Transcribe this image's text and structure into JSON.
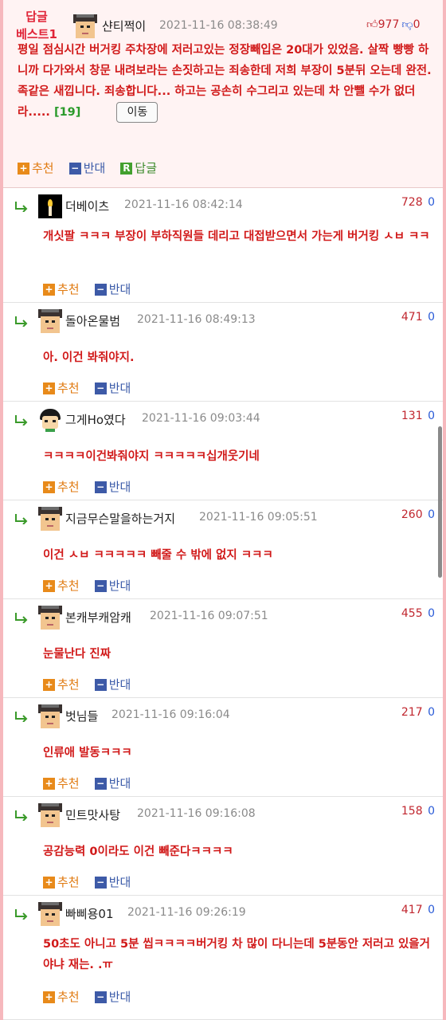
{
  "best": {
    "badge_line1": "답글",
    "badge_line2": "베스트1",
    "author": "샨티쩍이",
    "time": "2021-11-16 08:38:49",
    "up_count": "977",
    "down_count": "0",
    "text": "평일 점심시간 버거킹 주차장에 저러고있는 정장빼입은 20대가 있었음. 살짝 빵빵 하니까 다가와서 창문 내려보라는 손짓하고는 죄송한데 저희 부장이 5분뒤 오는데 완전.족같은 새낍니다. 죄송합니다... 하고는 공손히 수그리고 있는데 차 안뺄 수가 없더라.....",
    "comment_count": "[19]",
    "move_label": "이동",
    "recommend_label": "추천",
    "oppose_label": "반대",
    "reply_label": "답글"
  },
  "labels": {
    "recommend": "추천",
    "oppose": "반대"
  },
  "replies": [
    {
      "author": "더베이츠",
      "time": "2021-11-16 08:42:14",
      "up": "728",
      "down": "0",
      "text": "개싯팔 ㅋㅋㅋ 부장이 부하직원들 데리고 대접받으면서 가는게 버거킹 ㅅㅂ ㅋㅋ",
      "avatar": "candle"
    },
    {
      "author": "돌아온물범",
      "time": "2021-11-16 08:49:13",
      "up": "471",
      "down": "0",
      "text": "아. 이건 봐줘야지.",
      "avatar": "default"
    },
    {
      "author": "그게Ho였다",
      "time": "2021-11-16 09:03:44",
      "up": "131",
      "down": "0",
      "text": "ㅋㅋㅋㅋ이건봐줘야지 ㅋㅋㅋㅋㅋ십개웃기네",
      "avatar": "character"
    },
    {
      "author": "지금무슨말을하는거지",
      "time": "2021-11-16 09:05:51",
      "up": "260",
      "down": "0",
      "text": "이건 ㅅㅂ ㅋㅋㅋㅋㅋ 빼줄 수 밖에 없지 ㅋㅋㅋ",
      "avatar": "default"
    },
    {
      "author": "본캐부캐암캐",
      "time": "2021-11-16 09:07:51",
      "up": "455",
      "down": "0",
      "text": "눈물난다 진짜",
      "avatar": "default"
    },
    {
      "author": "벗님들",
      "time": "2021-11-16 09:16:04",
      "up": "217",
      "down": "0",
      "text": "인류애 발동ㅋㅋㅋ",
      "avatar": "default"
    },
    {
      "author": "민트맛사탕",
      "time": "2021-11-16 09:16:08",
      "up": "158",
      "down": "0",
      "text": "공감능력 0이라도 이건 빼준다ㅋㅋㅋㅋ",
      "avatar": "default"
    },
    {
      "author": "빠삐용01",
      "time": "2021-11-16 09:26:19",
      "up": "417",
      "down": "0",
      "text": "50초도 아니고 5분 씹ㅋㅋㅋㅋ버거킹 차 많이 다니는데 5분동안 저러고 있을거야냐 재는. .ㅠ",
      "avatar": "default"
    }
  ]
}
